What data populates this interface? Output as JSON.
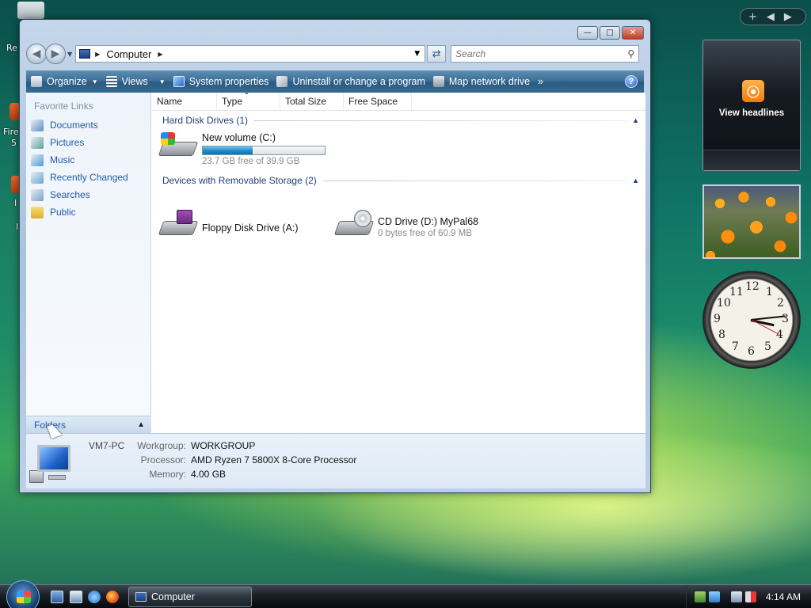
{
  "desktop": {
    "icon_labels": [
      "Re",
      "Fire",
      "5",
      "I",
      "I"
    ]
  },
  "window": {
    "address": {
      "location": "Computer"
    },
    "search": {
      "placeholder": "Search"
    },
    "toolbar": {
      "organize": "Organize",
      "views": "Views",
      "system_properties": "System properties",
      "uninstall": "Uninstall or change a program",
      "map_network_drive": "Map network drive",
      "more": "»",
      "help": "?"
    },
    "sidebar": {
      "title": "Favorite Links",
      "items": [
        {
          "label": "Documents",
          "icon": "documents-icon",
          "color": "#5a8fc7"
        },
        {
          "label": "Pictures",
          "icon": "pictures-icon",
          "color": "#5aa0a0"
        },
        {
          "label": "Music",
          "icon": "music-icon",
          "color": "#4f9bd6"
        },
        {
          "label": "Recently Changed",
          "icon": "recent-icon",
          "color": "#6aa6cf"
        },
        {
          "label": "Searches",
          "icon": "searches-icon",
          "color": "#7aa0c8"
        },
        {
          "label": "Public",
          "icon": "folder-icon",
          "color": "#e9c14a"
        }
      ],
      "folders_label": "Folders"
    },
    "columns": [
      "Name",
      "Type",
      "Total Size",
      "Free Space"
    ],
    "groups": [
      {
        "label": "Hard Disk Drives (1)",
        "items": [
          {
            "name": "New volume (C:)",
            "detail": "23.7 GB free of 39.9 GB",
            "used_fraction": 0.41
          }
        ]
      },
      {
        "label": "Devices with Removable Storage (2)",
        "items": [
          {
            "name": "Floppy Disk Drive (A:)",
            "detail": ""
          },
          {
            "name": "CD Drive (D:) MyPal68",
            "detail": "0 bytes free of 60.9 MB"
          }
        ]
      }
    ],
    "details": {
      "computer_name": "VM7-PC",
      "workgroup_label": "Workgroup:",
      "workgroup": "WORKGROUP",
      "processor_label": "Processor:",
      "processor": "AMD Ryzen 7 5800X 8-Core Processor",
      "memory_label": "Memory:",
      "memory": "4.00 GB"
    }
  },
  "gadgets": {
    "feed_text": "View headlines",
    "clock_numbers": [
      "12",
      "1",
      "2",
      "3",
      "4",
      "5",
      "6",
      "7",
      "8",
      "9",
      "10",
      "11"
    ]
  },
  "taskbar": {
    "task_label": "Computer",
    "time": "4:14 AM"
  }
}
